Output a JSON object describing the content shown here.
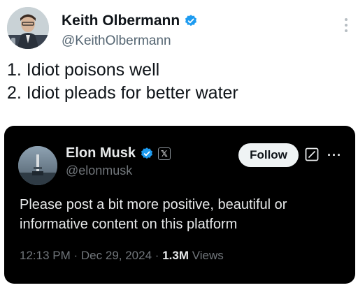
{
  "outer_tweet": {
    "author_name": "Keith Olbermann",
    "handle": "@KeithOlbermann",
    "lines": [
      "1. Idiot poisons well",
      "2. Idiot pleads for better water"
    ]
  },
  "quoted_tweet": {
    "author_name": "Elon Musk",
    "handle": "@elonmusk",
    "follow_label": "Follow",
    "lines": [
      "Please post a bit more positive, beautiful or",
      "informative content on this platform"
    ],
    "time": "12:13 PM",
    "date": "Dec 29, 2024",
    "separator": "·",
    "views_count": "1.3M",
    "views_label": "Views"
  },
  "colors": {
    "verified_blue": "#1d9bf0",
    "card_background": "#000000",
    "text_primary": "#0f1419",
    "text_secondary": "#536471"
  },
  "icons": [
    "verified-badge-icon",
    "more-options-icon",
    "x-affiliation-icon",
    "grok-icon"
  ]
}
